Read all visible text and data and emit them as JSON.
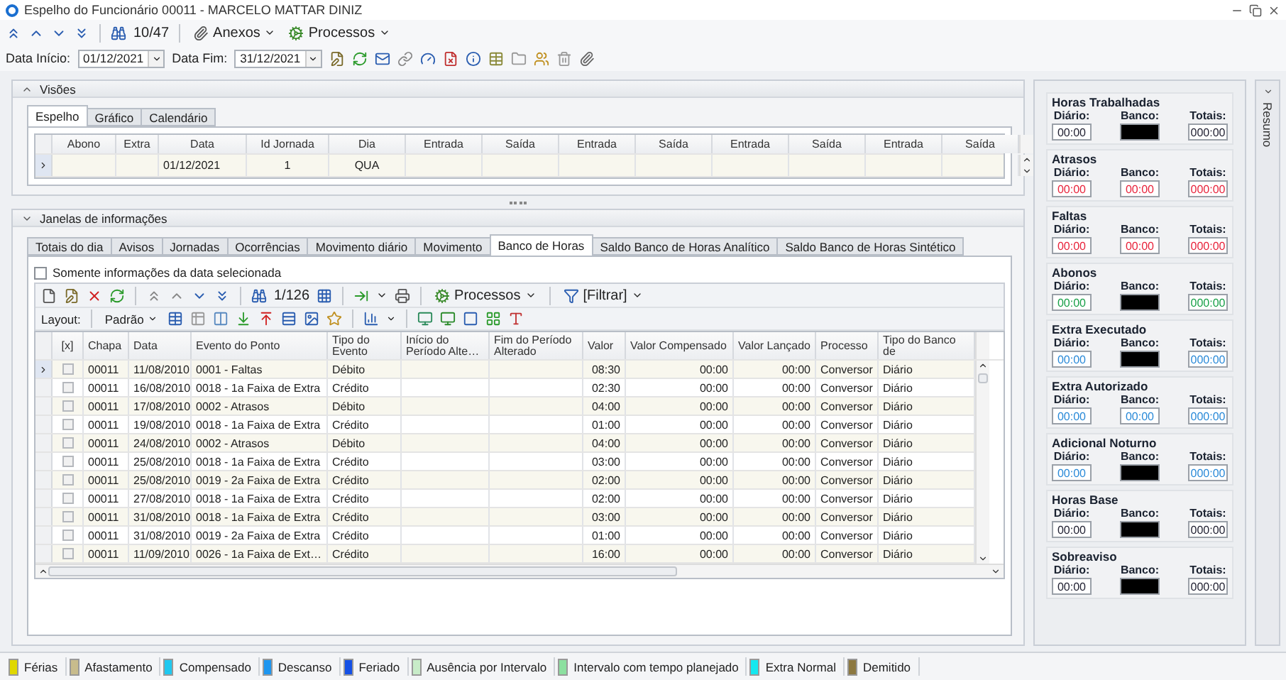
{
  "window": {
    "title": "Espelho do Funcionário 00011 - MARCELO MATTAR DINIZ"
  },
  "navigator": {
    "position": "10/47",
    "attachments": "Anexos",
    "processes": "Processos"
  },
  "date_filter": {
    "start_label": "Data Início:",
    "start": "01/12/2021",
    "end_label": "Data Fim:",
    "end": "31/12/2021"
  },
  "views": {
    "title": "Visões",
    "tabs": [
      {
        "label": "Espelho",
        "selected": true
      },
      {
        "label": "Gráfico",
        "selected": false
      },
      {
        "label": "Calendário",
        "selected": false
      }
    ],
    "columns": [
      "Abono",
      "Extra",
      "Data",
      "Id Jornada",
      "Dia",
      "Entrada",
      "Saída",
      "Entrada",
      "Saída",
      "Entrada",
      "Saída",
      "Entrada",
      "Saída"
    ],
    "rows": [
      {
        "selected": true,
        "data": "01/12/2021",
        "jornada": "1",
        "dia": "QUA"
      }
    ]
  },
  "info": {
    "title": "Janelas de informações",
    "tabs": [
      {
        "label": "Totais do dia",
        "selected": false
      },
      {
        "label": "Avisos",
        "selected": false
      },
      {
        "label": "Jornadas",
        "selected": false
      },
      {
        "label": "Ocorrências",
        "selected": false
      },
      {
        "label": "Movimento diário",
        "selected": false
      },
      {
        "label": "Movimento",
        "selected": false
      },
      {
        "label": "Banco de Horas",
        "selected": true
      },
      {
        "label": "Saldo Banco de Horas Analítico",
        "selected": false
      },
      {
        "label": "Saldo Banco de Horas Sintético",
        "selected": false
      }
    ],
    "only_selected_date": {
      "label": "Somente informações da data selecionada",
      "checked": false
    },
    "record_position": "1/126",
    "processes": "Processos",
    "filter": "[Filtrar]",
    "layout_label": "Layout:",
    "layout": "Padrão",
    "columns": [
      "[x]",
      "Chapa",
      "Data",
      "Evento do Ponto",
      "Tipo do Evento",
      "Início do Período Alte…",
      "Fim do Período Alterado",
      "Valor",
      "Valor Compensado",
      "Valor Lançado",
      "Processo",
      "Tipo do Banco de"
    ],
    "rows": [
      {
        "selected": true,
        "checked": false,
        "chapa": "00011",
        "data": "11/08/2010",
        "evento": "0001 - Faltas",
        "tipo": "Débito",
        "valor": "08:30",
        "compensado": "00:00",
        "lancado": "00:00",
        "processo": "Conversor",
        "banco": "Diário"
      },
      {
        "selected": false,
        "checked": false,
        "chapa": "00011",
        "data": "16/08/2010",
        "evento": "0018 - 1a Faixa de Extra",
        "tipo": "Crédito",
        "valor": "02:30",
        "compensado": "00:00",
        "lancado": "00:00",
        "processo": "Conversor",
        "banco": "Diário"
      },
      {
        "selected": false,
        "checked": false,
        "chapa": "00011",
        "data": "17/08/2010",
        "evento": "0002 - Atrasos",
        "tipo": "Débito",
        "valor": "04:00",
        "compensado": "00:00",
        "lancado": "00:00",
        "processo": "Conversor",
        "banco": "Diário"
      },
      {
        "selected": false,
        "checked": false,
        "chapa": "00011",
        "data": "19/08/2010",
        "evento": "0018 - 1a Faixa de Extra",
        "tipo": "Crédito",
        "valor": "01:00",
        "compensado": "00:00",
        "lancado": "00:00",
        "processo": "Conversor",
        "banco": "Diário"
      },
      {
        "selected": false,
        "checked": false,
        "chapa": "00011",
        "data": "24/08/2010",
        "evento": "0002 - Atrasos",
        "tipo": "Débito",
        "valor": "04:00",
        "compensado": "00:00",
        "lancado": "00:00",
        "processo": "Conversor",
        "banco": "Diário"
      },
      {
        "selected": false,
        "checked": false,
        "chapa": "00011",
        "data": "25/08/2010",
        "evento": "0018 - 1a Faixa de Extra",
        "tipo": "Crédito",
        "valor": "03:00",
        "compensado": "00:00",
        "lancado": "00:00",
        "processo": "Conversor",
        "banco": "Diário"
      },
      {
        "selected": false,
        "checked": false,
        "chapa": "00011",
        "data": "25/08/2010",
        "evento": "0019 - 2a Faixa de Extra",
        "tipo": "Crédito",
        "valor": "02:00",
        "compensado": "00:00",
        "lancado": "00:00",
        "processo": "Conversor",
        "banco": "Diário"
      },
      {
        "selected": false,
        "checked": false,
        "chapa": "00011",
        "data": "27/08/2010",
        "evento": "0018 - 1a Faixa de Extra",
        "tipo": "Crédito",
        "valor": "02:00",
        "compensado": "00:00",
        "lancado": "00:00",
        "processo": "Conversor",
        "banco": "Diário"
      },
      {
        "selected": false,
        "checked": false,
        "chapa": "00011",
        "data": "31/08/2010",
        "evento": "0018 - 1a Faixa de Extra",
        "tipo": "Crédito",
        "valor": "03:00",
        "compensado": "00:00",
        "lancado": "00:00",
        "processo": "Conversor",
        "banco": "Diário"
      },
      {
        "selected": false,
        "checked": false,
        "chapa": "00011",
        "data": "31/08/2010",
        "evento": "0019 - 2a Faixa de Extra",
        "tipo": "Crédito",
        "valor": "01:00",
        "compensado": "00:00",
        "lancado": "00:00",
        "processo": "Conversor",
        "banco": "Diário"
      },
      {
        "selected": false,
        "checked": false,
        "chapa": "00011",
        "data": "11/09/2010",
        "evento": "0026 - 1a Faixa de Ext…",
        "tipo": "Crédito",
        "valor": "16:00",
        "compensado": "00:00",
        "lancado": "00:00",
        "processo": "Conversor",
        "banco": "Diário"
      }
    ]
  },
  "summary": {
    "title": "Resumo",
    "groups": [
      {
        "title": "Horas Trabalhadas",
        "color": "#222233",
        "cells": [
          {
            "label": "Diário:",
            "value": "00:00",
            "masked": false
          },
          {
            "label": "Banco:",
            "masked": true
          },
          {
            "label": "Totais:",
            "value": "000:00",
            "masked": false
          }
        ]
      },
      {
        "title": "Atrasos",
        "color": "#e8243c",
        "cells": [
          {
            "label": "Diário:",
            "value": "00:00",
            "masked": false
          },
          {
            "label": "Banco:",
            "value": "00:00",
            "masked": false
          },
          {
            "label": "Totais:",
            "value": "000:00",
            "masked": false
          }
        ]
      },
      {
        "title": "Faltas",
        "color": "#e8243c",
        "cells": [
          {
            "label": "Diário:",
            "value": "00:00",
            "masked": false
          },
          {
            "label": "Banco:",
            "value": "00:00",
            "masked": false
          },
          {
            "label": "Totais:",
            "value": "000:00",
            "masked": false
          }
        ]
      },
      {
        "title": "Abonos",
        "color": "#18a048",
        "cells": [
          {
            "label": "Diário:",
            "value": "00:00",
            "masked": false
          },
          {
            "label": "Banco:",
            "masked": true
          },
          {
            "label": "Totais:",
            "value": "000:00",
            "masked": false
          }
        ]
      },
      {
        "title": "Extra Executado",
        "color": "#2a8ad8",
        "cells": [
          {
            "label": "Diário:",
            "value": "00:00",
            "masked": false
          },
          {
            "label": "Banco:",
            "masked": true
          },
          {
            "label": "Totais:",
            "value": "000:00",
            "masked": false
          }
        ]
      },
      {
        "title": "Extra Autorizado",
        "color": "#2a8ad8",
        "cells": [
          {
            "label": "Diário:",
            "value": "00:00",
            "masked": false
          },
          {
            "label": "Banco:",
            "value": "00:00",
            "masked": false
          },
          {
            "label": "Totais:",
            "value": "000:00",
            "masked": false
          }
        ]
      },
      {
        "title": "Adicional Noturno",
        "color": "#2a8ad8",
        "cells": [
          {
            "label": "Diário:",
            "value": "00:00",
            "masked": false
          },
          {
            "label": "Banco:",
            "masked": true
          },
          {
            "label": "Totais:",
            "value": "000:00",
            "masked": false
          }
        ]
      },
      {
        "title": "Horas Base",
        "color": "#222233",
        "cells": [
          {
            "label": "Diário:",
            "value": "00:00",
            "masked": false
          },
          {
            "label": "Banco:",
            "masked": true
          },
          {
            "label": "Totais:",
            "value": "000:00",
            "masked": false
          }
        ]
      },
      {
        "title": "Sobreaviso",
        "color": "#222233",
        "cells": [
          {
            "label": "Diário:",
            "value": "00:00",
            "masked": false
          },
          {
            "label": "Banco:",
            "masked": true
          },
          {
            "label": "Totais:",
            "value": "000:00",
            "masked": false
          }
        ]
      }
    ]
  },
  "legend": [
    {
      "label": "Férias",
      "color": "#e0d800"
    },
    {
      "label": "Afastamento",
      "color": "#c8bc8c"
    },
    {
      "label": "Compensado",
      "color": "#1ec8f0"
    },
    {
      "label": "Descanso",
      "color": "#1e96f0"
    },
    {
      "label": "Feriado",
      "color": "#1450e6"
    },
    {
      "label": "Ausência por Intervalo",
      "color": "#c8ecc8"
    },
    {
      "label": "Intervalo com tempo planejado",
      "color": "#8ce0a0"
    },
    {
      "label": "Extra Normal",
      "color": "#14e8f0"
    },
    {
      "label": "Demitido",
      "color": "#8c7840"
    }
  ]
}
